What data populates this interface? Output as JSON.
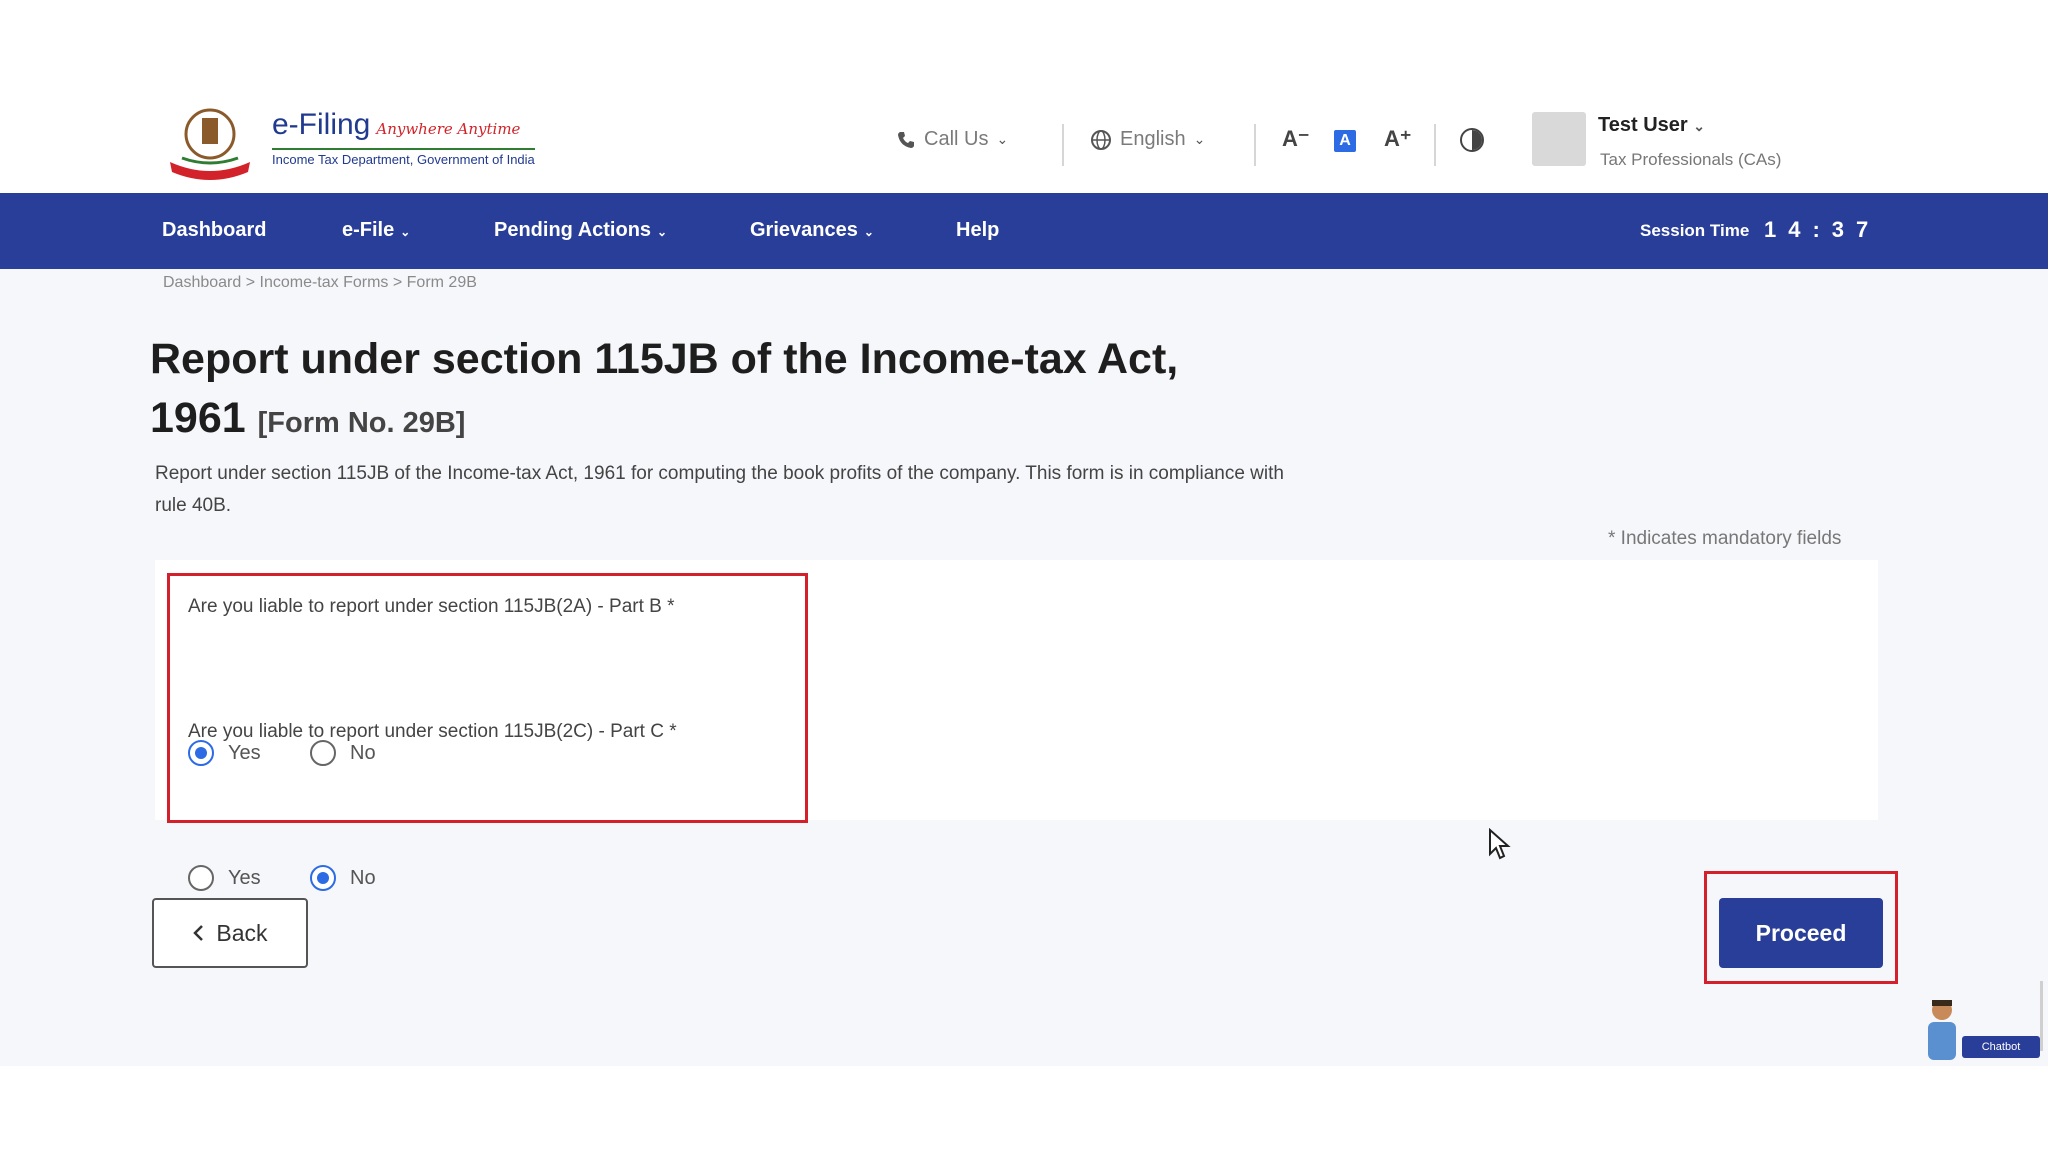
{
  "header": {
    "brand_title": "e-Filing",
    "brand_tagline": "Anywhere Anytime",
    "brand_subtitle": "Income Tax Department, Government of India",
    "call_us": "Call Us",
    "language": "English",
    "font_decrease": "A⁻",
    "font_default": "A",
    "font_increase": "A⁺",
    "user_name": "Test User",
    "user_role": "Tax Professionals (CAs)"
  },
  "nav": {
    "items": [
      {
        "label": "Dashboard",
        "has_menu": false
      },
      {
        "label": "e-File",
        "has_menu": true
      },
      {
        "label": "Pending Actions",
        "has_menu": true
      },
      {
        "label": "Grievances",
        "has_menu": true
      },
      {
        "label": "Help",
        "has_menu": false
      }
    ],
    "session_label": "Session Time",
    "session_value": "14:37"
  },
  "breadcrumb": "Dashboard  >  Income-tax Forms  >  Form 29B",
  "page": {
    "title": "Report under section 115JB of the Income-tax Act, 1961",
    "form_no": "[Form No. 29B]",
    "description": "Report under section 115JB of the Income-tax Act, 1961 for computing the book profits of the company. This form is in compliance with rule 40B.",
    "mandatory_note": "* Indicates mandatory fields"
  },
  "questions": [
    {
      "text": "Are you liable to report under section 115JB(2A) - Part B *",
      "options": [
        "Yes",
        "No"
      ],
      "selected": "Yes"
    },
    {
      "text": "Are you liable to report under section 115JB(2C) - Part C *",
      "options": [
        "Yes",
        "No"
      ],
      "selected": "No"
    }
  ],
  "actions": {
    "back_label": "Back",
    "proceed_label": "Proceed"
  },
  "chatbot_label": "Chatbot",
  "colors": {
    "nav_bg": "#293e98",
    "accent": "#2d6be4",
    "highlight": "#d3202a"
  }
}
